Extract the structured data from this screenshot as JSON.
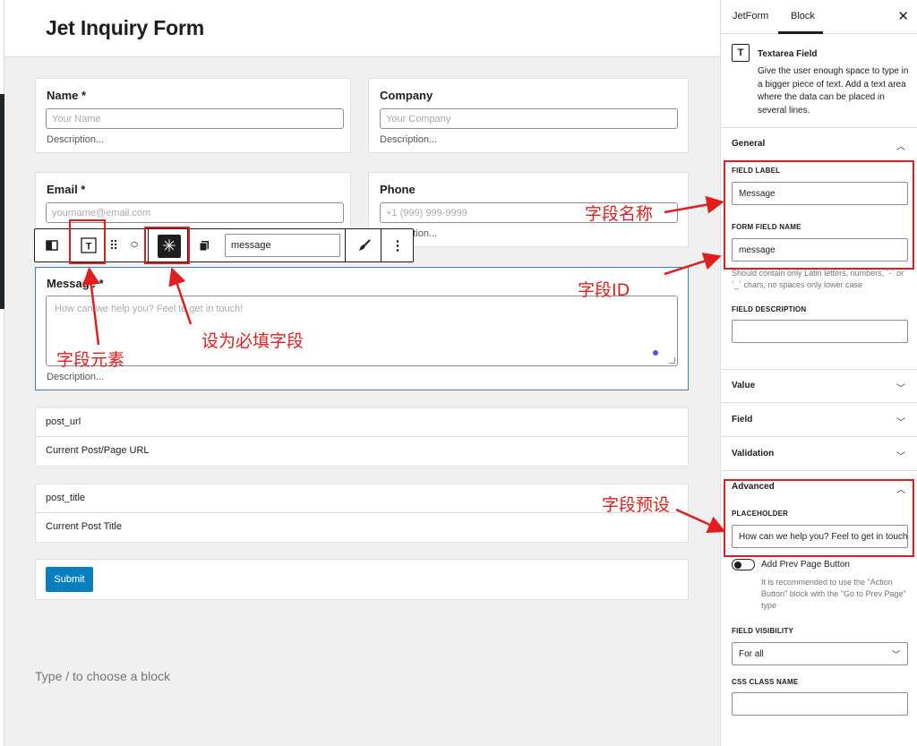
{
  "form": {
    "title": "Jet Inquiry Form",
    "name_label": "Name *",
    "name_placeholder": "Your Name",
    "company_label": "Company",
    "company_placeholder": "Your Company",
    "email_label": "Email *",
    "email_placeholder": "yourname@email.com",
    "phone_label": "Phone",
    "phone_placeholder": "+1 (999) 999-9999",
    "description": "Description...",
    "message_label": "Message *",
    "message_placeholder": "How can we help you? Feel to get in touch!",
    "post_url_name": "post_url",
    "post_url_label": "Current Post/Page URL",
    "post_title_name": "post_title",
    "post_title_label": "Current Post Title",
    "submit_label": "Submit",
    "appender_hint": "Type / to choose a block"
  },
  "toolbar": {
    "field_name_value": "message",
    "more_icon": "⋮"
  },
  "sidebar": {
    "tabs": [
      "JetForm",
      "Block"
    ],
    "active_tab": "Block",
    "block_title": "Textarea Field",
    "block_description": "Give the user enough space to type in a bigger piece of text. Add a text area where the data can be placed in several lines.",
    "general_title": "General",
    "field_label_title": "FIELD LABEL",
    "field_label_value": "Message",
    "form_field_name_title": "FORM FIELD NAME",
    "form_field_name_value": "message",
    "field_name_help": "Should contain only Latin letters, numbers, `-` or `_` chars, no spaces only lower case",
    "field_description_title": "FIELD DESCRIPTION",
    "panels": [
      "Value",
      "Field",
      "Validation"
    ],
    "advanced_title": "Advanced",
    "placeholder_title": "PLACEHOLDER",
    "placeholder_value": "How can we help you? Feel to get in touch!",
    "prev_page_label": "Add Prev Page Button",
    "prev_page_help": "It is recommended to use the \"Action Button\" block with the \"Go to Prev Page\" type",
    "visibility_title": "FIELD VISIBILITY",
    "visibility_value": "For all",
    "css_class_title": "CSS CLASS NAME"
  },
  "annotations": {
    "field_name_cn": "字段名称",
    "field_id_cn": "字段ID",
    "field_element_cn": "字段元素",
    "required_cn": "设为必填字段",
    "preset_cn": "字段预设"
  },
  "colors": {
    "accent": "#0a7fbf",
    "annotation": "#e01e1e",
    "selected_border": "#3582c4"
  }
}
